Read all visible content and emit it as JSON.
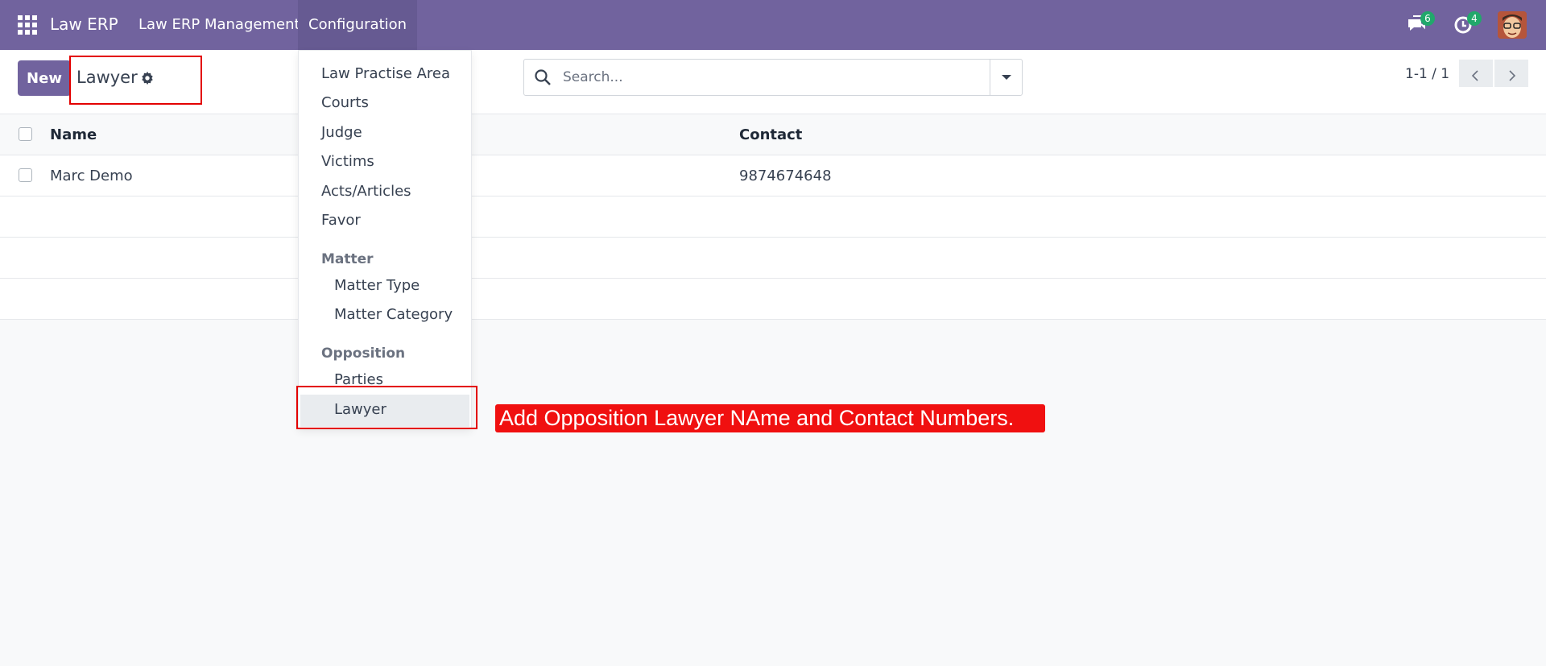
{
  "navbar": {
    "app_name": "Law ERP",
    "menu": [
      "Law ERP Management",
      "Configuration"
    ],
    "messages_count": "6",
    "activities_count": "4",
    "bg_color": "#71639e"
  },
  "control_panel": {
    "new_label": "New",
    "breadcrumb": "Lawyer",
    "search_placeholder": "Search...",
    "pager": "1-1 / 1"
  },
  "list": {
    "columns": [
      "Name",
      "Contact"
    ],
    "rows": [
      {
        "name": "Marc Demo",
        "contact": "9874674648"
      }
    ]
  },
  "dropdown": {
    "items": [
      "Law Practise Area",
      "Courts",
      "Judge",
      "Victims",
      "Acts/Articles",
      "Favor"
    ],
    "matter_header": "Matter",
    "matter_items": [
      "Matter Type",
      "Matter Category"
    ],
    "opposition_header": "Opposition",
    "opposition_items": [
      "Parties",
      "Lawyer"
    ]
  },
  "annotation": {
    "text": "Add Opposition Lawyer NAme and Contact Numbers. ",
    "color": "#f01010"
  }
}
